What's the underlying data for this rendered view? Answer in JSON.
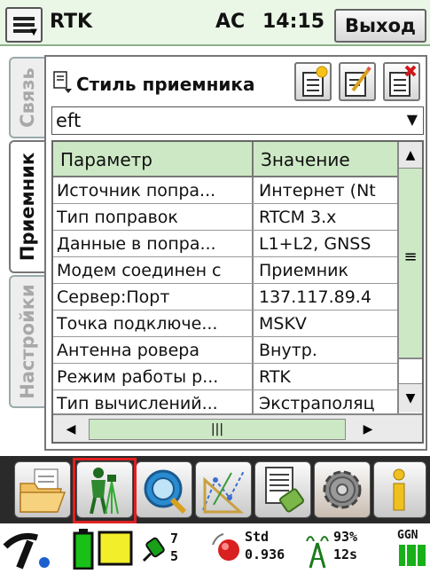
{
  "titlebar": {
    "title": "RTK",
    "status": "AC",
    "time": "14:15",
    "exit_label": "Выход"
  },
  "tabs": [
    {
      "label": "Связь",
      "active": false
    },
    {
      "label": "Приемник",
      "active": true
    },
    {
      "label": "Настройки",
      "active": false
    }
  ],
  "panel": {
    "title": "Стиль приемника",
    "style_value": "eft"
  },
  "table": {
    "headers": [
      "Параметр",
      "Значение"
    ],
    "rows": [
      {
        "param": "Источник попра...",
        "value": "Интернет (Nt"
      },
      {
        "param": "Тип поправок",
        "value": "RTCM 3.x"
      },
      {
        "param": "Данные в попра...",
        "value": "L1+L2, GNSS"
      },
      {
        "param": "Модем соединен с",
        "value": "Приемник"
      },
      {
        "param": "Сервер:Порт",
        "value": "137.117.89.4"
      },
      {
        "param": "Точка подключе...",
        "value": "MSKV"
      },
      {
        "param": "Антенна ровера",
        "value": "Внутр."
      },
      {
        "param": "Режим работы р...",
        "value": "RTK"
      },
      {
        "param": "Тип вычислений...",
        "value": "Экстраполяц"
      }
    ]
  },
  "statusbar": {
    "sat_gps": "7",
    "sat_glonass": "5",
    "solution": "Std",
    "precision": "0.936",
    "link_quality": "93%",
    "age": "12s",
    "ggn": "GGN"
  },
  "colors": {
    "header_green": "#cde8c5",
    "highlight_red": "#e02020",
    "toolbar_bg": "#2a2a2a"
  },
  "icons": [
    "start-menu-icon",
    "style-icon",
    "new-style-icon",
    "edit-style-icon",
    "delete-style-icon",
    "folder-icon",
    "surveyor-icon",
    "magnifier-icon",
    "cogo-icon",
    "data-icon",
    "gear-icon",
    "info-icon",
    "gnss-receiver-icon",
    "bluetooth-icon",
    "battery-icon",
    "satellite-icon",
    "antenna-icon",
    "radio-icon"
  ]
}
